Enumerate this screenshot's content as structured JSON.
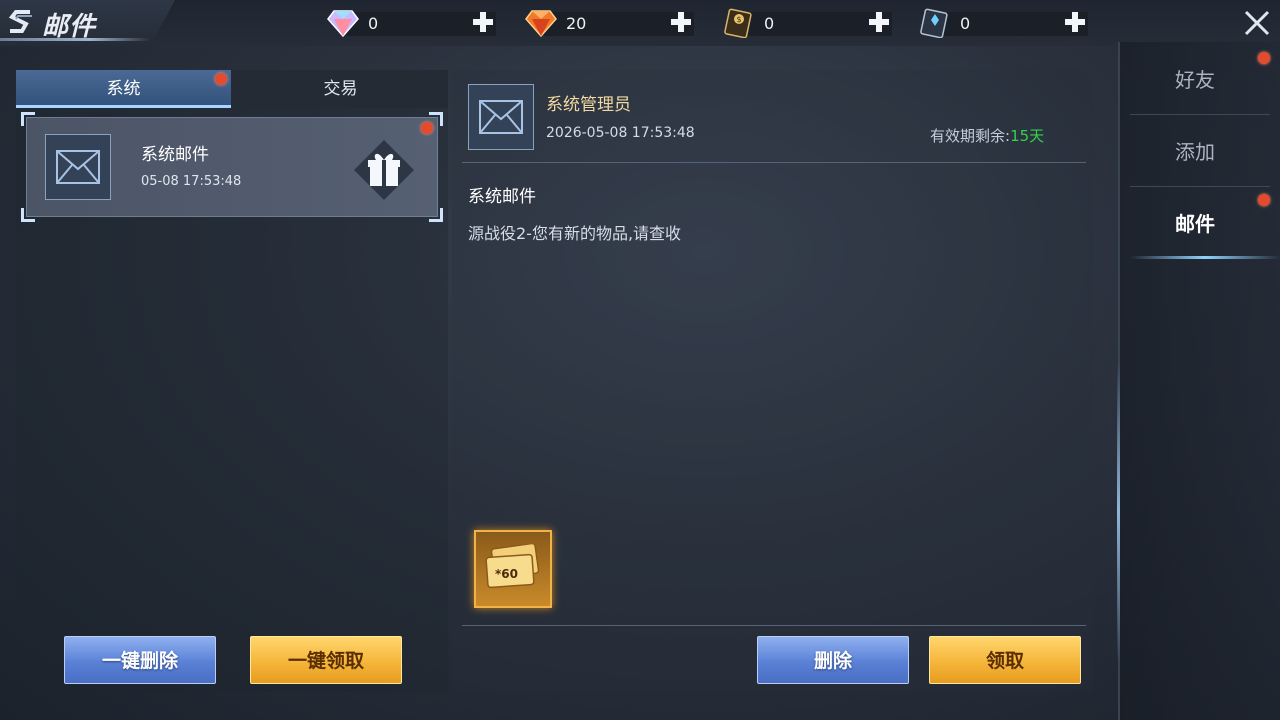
{
  "header": {
    "title": "邮件",
    "currencies": [
      {
        "icon": "rainbow-diamond-icon",
        "value": "0"
      },
      {
        "icon": "orange-diamond-icon",
        "value": "20"
      },
      {
        "icon": "gold-coin-card-icon",
        "value": "0"
      },
      {
        "icon": "silver-card-icon",
        "value": "0"
      }
    ]
  },
  "left": {
    "tabs": [
      {
        "label": "系统",
        "active": true,
        "badge": true
      },
      {
        "label": "交易",
        "active": false,
        "badge": false
      }
    ],
    "mail_list": [
      {
        "title": "系统邮件",
        "time": "05-08 17:53:48",
        "unread": true,
        "has_gift": true
      }
    ],
    "buttons": {
      "delete_all": "一键删除",
      "claim_all": "一键领取"
    }
  },
  "detail": {
    "sender": "系统管理员",
    "sent_time": "2026-05-08 17:53:48",
    "expiry_label": "有效期剩余:",
    "expiry_days": "15天",
    "subject": "系统邮件",
    "body": "源战役2-您有新的物品,请查收",
    "attachment": {
      "icon": "ticket-icon",
      "count": "*60"
    },
    "buttons": {
      "delete": "删除",
      "claim": "领取"
    }
  },
  "sidenav": {
    "items": [
      {
        "label": "好友",
        "active": false,
        "badge": true
      },
      {
        "label": "添加",
        "active": false,
        "badge": false
      },
      {
        "label": "邮件",
        "active": true,
        "badge": true
      }
    ]
  },
  "colors": {
    "accent_blue": "#5a81d6",
    "accent_gold": "#f5b63a",
    "badge_red": "#e44b2e",
    "expiry_green": "#36d04a",
    "sender_gold": "#f2d9a1"
  }
}
